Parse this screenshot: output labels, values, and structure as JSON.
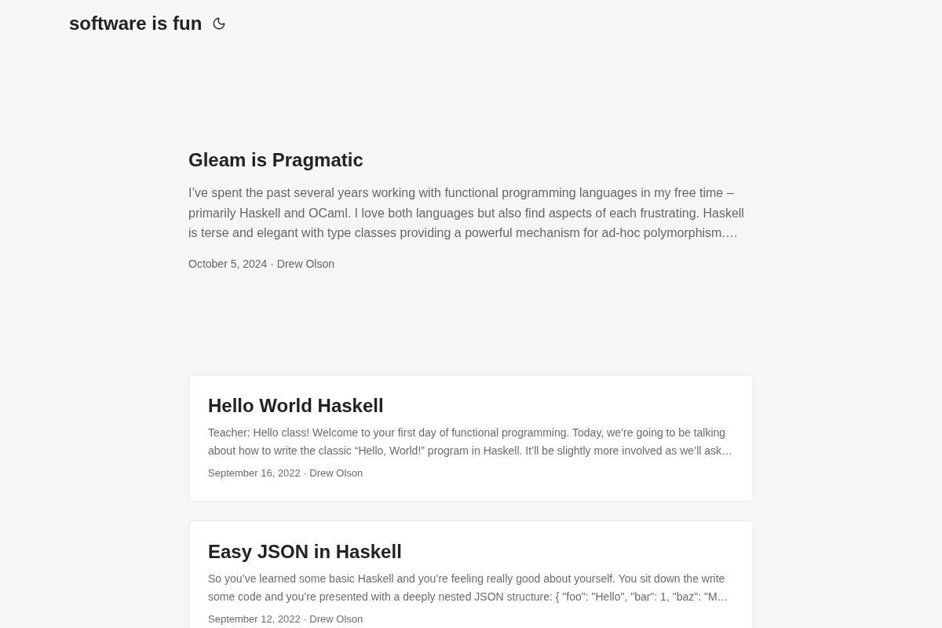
{
  "header": {
    "site_title": "software is fun"
  },
  "featured_post": {
    "title": "Gleam is Pragmatic",
    "excerpt": "I’ve spent the past several years working with functional programming languages in my free time – primarily Haskell and OCaml. I love both languages but also find aspects of each frustrating. Haskell is terse and elegant with type classes providing a powerful mechanism for ad-hoc polymorphism.…",
    "meta": "October 5, 2024 · Drew Olson"
  },
  "posts": [
    {
      "title": "Hello World Haskell",
      "excerpt": "Teacher: Hello class! Welcome to your first day of functional programming. Today, we’re going to be talking about how to write the classic “Hello, World!” program in Haskell. It’ll be slightly more involved as we’ll ask…",
      "meta": "September 16, 2022 · Drew Olson"
    },
    {
      "title": "Easy JSON in Haskell",
      "excerpt": "So you’ve learned some basic Haskell and you’re feeling really good about yourself. You sit down the write some code and you’re presented with a deeply nested JSON structure: { \"foo\": \"Hello\", \"bar\": 1, \"baz\": \"M…",
      "meta": "September 12, 2022 · Drew Olson"
    }
  ]
}
